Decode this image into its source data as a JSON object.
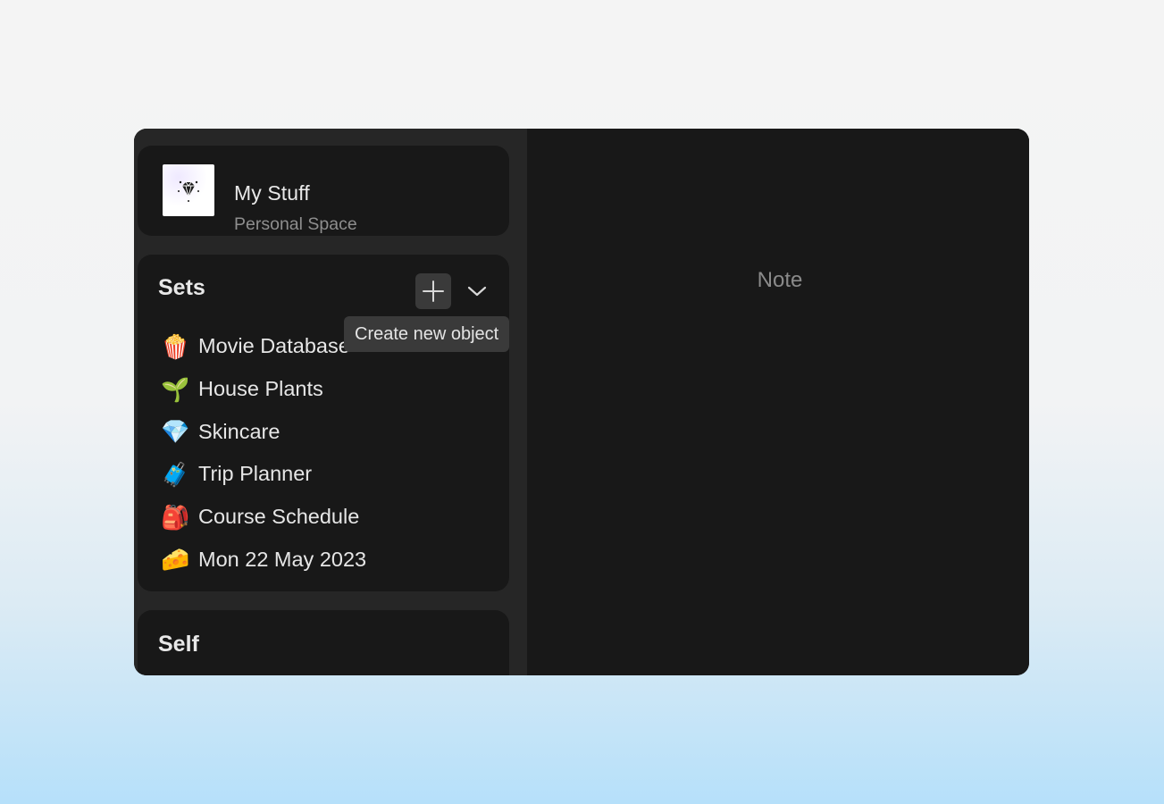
{
  "space": {
    "title": "My Stuff",
    "subtitle": "Personal Space",
    "icon": "diamond-logo-icon"
  },
  "sets": {
    "title": "Sets",
    "add_icon": "plus-icon",
    "collapse_icon": "chevron-down-icon",
    "tooltip": "Create new object",
    "items": [
      {
        "emoji": "🍿",
        "icon": "popcorn-icon",
        "label": "Movie Database"
      },
      {
        "emoji": "🌱",
        "icon": "seedling-icon",
        "label": "House Plants"
      },
      {
        "emoji": "💎",
        "icon": "gem-icon",
        "label": "Skincare"
      },
      {
        "emoji": "🧳",
        "icon": "suitcase-icon",
        "label": "Trip Planner"
      },
      {
        "emoji": "🎒",
        "icon": "backpack-icon",
        "label": "Course Schedule"
      },
      {
        "emoji": "🧀",
        "icon": "cheese-icon",
        "label": "Mon 22 May 2023"
      }
    ]
  },
  "self": {
    "title": "Self"
  },
  "main": {
    "label": "Note"
  }
}
